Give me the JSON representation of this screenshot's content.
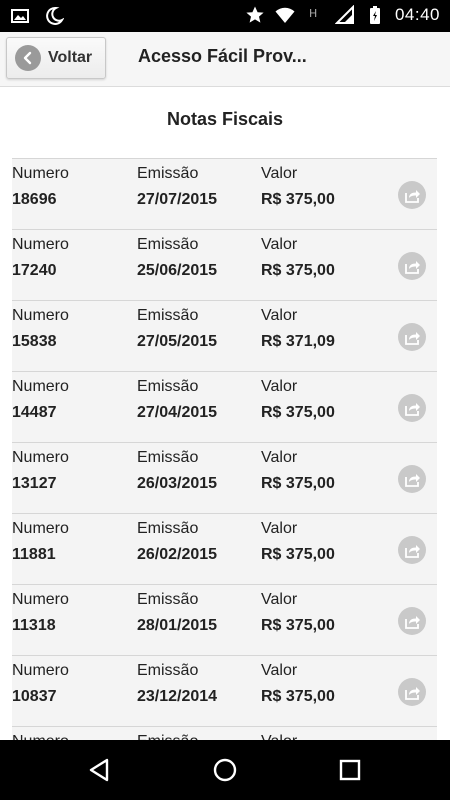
{
  "status_bar": {
    "time": "04:40",
    "icons": [
      "image-icon",
      "moon-icon",
      "star-icon",
      "wifi-icon",
      "h-signal-icon",
      "cellular-icon",
      "battery-icon"
    ]
  },
  "header": {
    "back_label": "Voltar",
    "title": "Acesso Fácil Prov..."
  },
  "main": {
    "section_title": "Notas Fiscais",
    "columns": {
      "numero": "Numero",
      "emissao": "Emissão",
      "valor": "Valor"
    },
    "rows": [
      {
        "numero": "18696",
        "emissao": "27/07/2015",
        "valor": "R$ 375,00"
      },
      {
        "numero": "17240",
        "emissao": "25/06/2015",
        "valor": "R$ 375,00"
      },
      {
        "numero": "15838",
        "emissao": "27/05/2015",
        "valor": "R$ 371,09"
      },
      {
        "numero": "14487",
        "emissao": "27/04/2015",
        "valor": "R$ 375,00"
      },
      {
        "numero": "13127",
        "emissao": "26/03/2015",
        "valor": "R$ 375,00"
      },
      {
        "numero": "11881",
        "emissao": "26/02/2015",
        "valor": "R$ 375,00"
      },
      {
        "numero": "11318",
        "emissao": "28/01/2015",
        "valor": "R$ 375,00"
      },
      {
        "numero": "10837",
        "emissao": "23/12/2014",
        "valor": "R$ 375,00"
      },
      {
        "numero": "",
        "emissao": "",
        "valor": ""
      }
    ]
  },
  "nav_bar": {
    "buttons": [
      "back-nav-icon",
      "home-nav-icon",
      "recents-nav-icon"
    ]
  },
  "colors": {
    "status_bar": "#000000",
    "row_bg": "#f4f4f4",
    "share_icon_bg": "#c9c9c9"
  }
}
